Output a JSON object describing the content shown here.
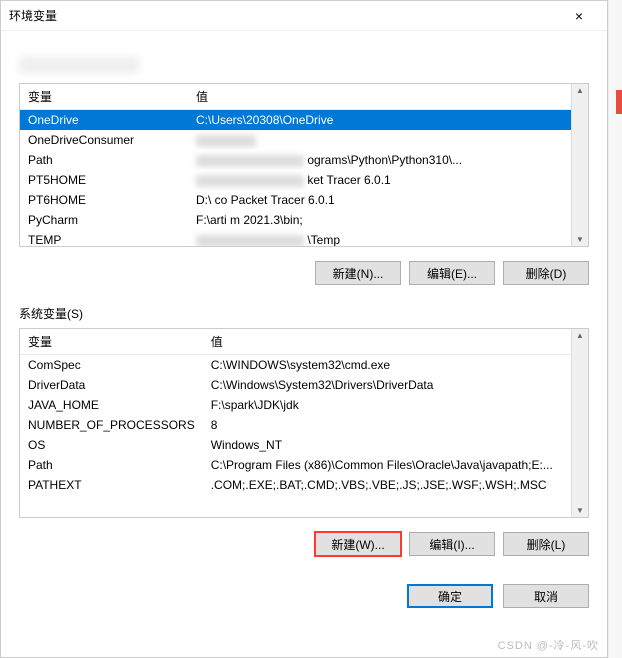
{
  "dialog": {
    "title": "环境变量",
    "close_label": "×"
  },
  "user_section": {
    "heading_redacted": "████████ 的用户变量(U)",
    "headers": {
      "name": "变量",
      "value": "值"
    },
    "rows": [
      {
        "name": "OneDrive",
        "value": "C:\\Users\\20308\\OneDrive",
        "selected": true
      },
      {
        "name": "OneDriveConsumer",
        "value": "",
        "value_redacted": true
      },
      {
        "name": "Path",
        "value": "ograms\\Python\\Python310\\...",
        "prefix_redacted": true
      },
      {
        "name": "PT5HOME",
        "value": "ket Tracer 6.0.1",
        "prefix_redacted": true
      },
      {
        "name": "PT6HOME",
        "value": "D:\\           co Packet Tracer 6.0.1",
        "mid_redacted": true
      },
      {
        "name": "PyCharm",
        "value": "F:\\arti           m 2021.3\\bin;",
        "mid_redacted": true
      },
      {
        "name": "TEMP",
        "value": "\\Temp",
        "prefix_redacted": true
      }
    ],
    "buttons": {
      "new": "新建(N)...",
      "edit": "编辑(E)...",
      "delete": "删除(D)"
    }
  },
  "system_section": {
    "label": "系统变量(S)",
    "headers": {
      "name": "变量",
      "value": "值"
    },
    "rows": [
      {
        "name": "ComSpec",
        "value": "C:\\WINDOWS\\system32\\cmd.exe"
      },
      {
        "name": "DriverData",
        "value": "C:\\Windows\\System32\\Drivers\\DriverData"
      },
      {
        "name": "JAVA_HOME",
        "value": "F:\\spark\\JDK\\jdk"
      },
      {
        "name": "NUMBER_OF_PROCESSORS",
        "value": "8"
      },
      {
        "name": "OS",
        "value": "Windows_NT"
      },
      {
        "name": "Path",
        "value": "C:\\Program Files (x86)\\Common Files\\Oracle\\Java\\javapath;E:..."
      },
      {
        "name": "PATHEXT",
        "value": ".COM;.EXE;.BAT;.CMD;.VBS;.VBE;.JS;.JSE;.WSF;.WSH;.MSC"
      }
    ],
    "buttons": {
      "new": "新建(W)...",
      "edit": "编辑(I)...",
      "delete": "删除(L)"
    }
  },
  "footer": {
    "ok": "确定",
    "cancel": "取消"
  },
  "watermark": "CSDN @-冷-风-吹"
}
